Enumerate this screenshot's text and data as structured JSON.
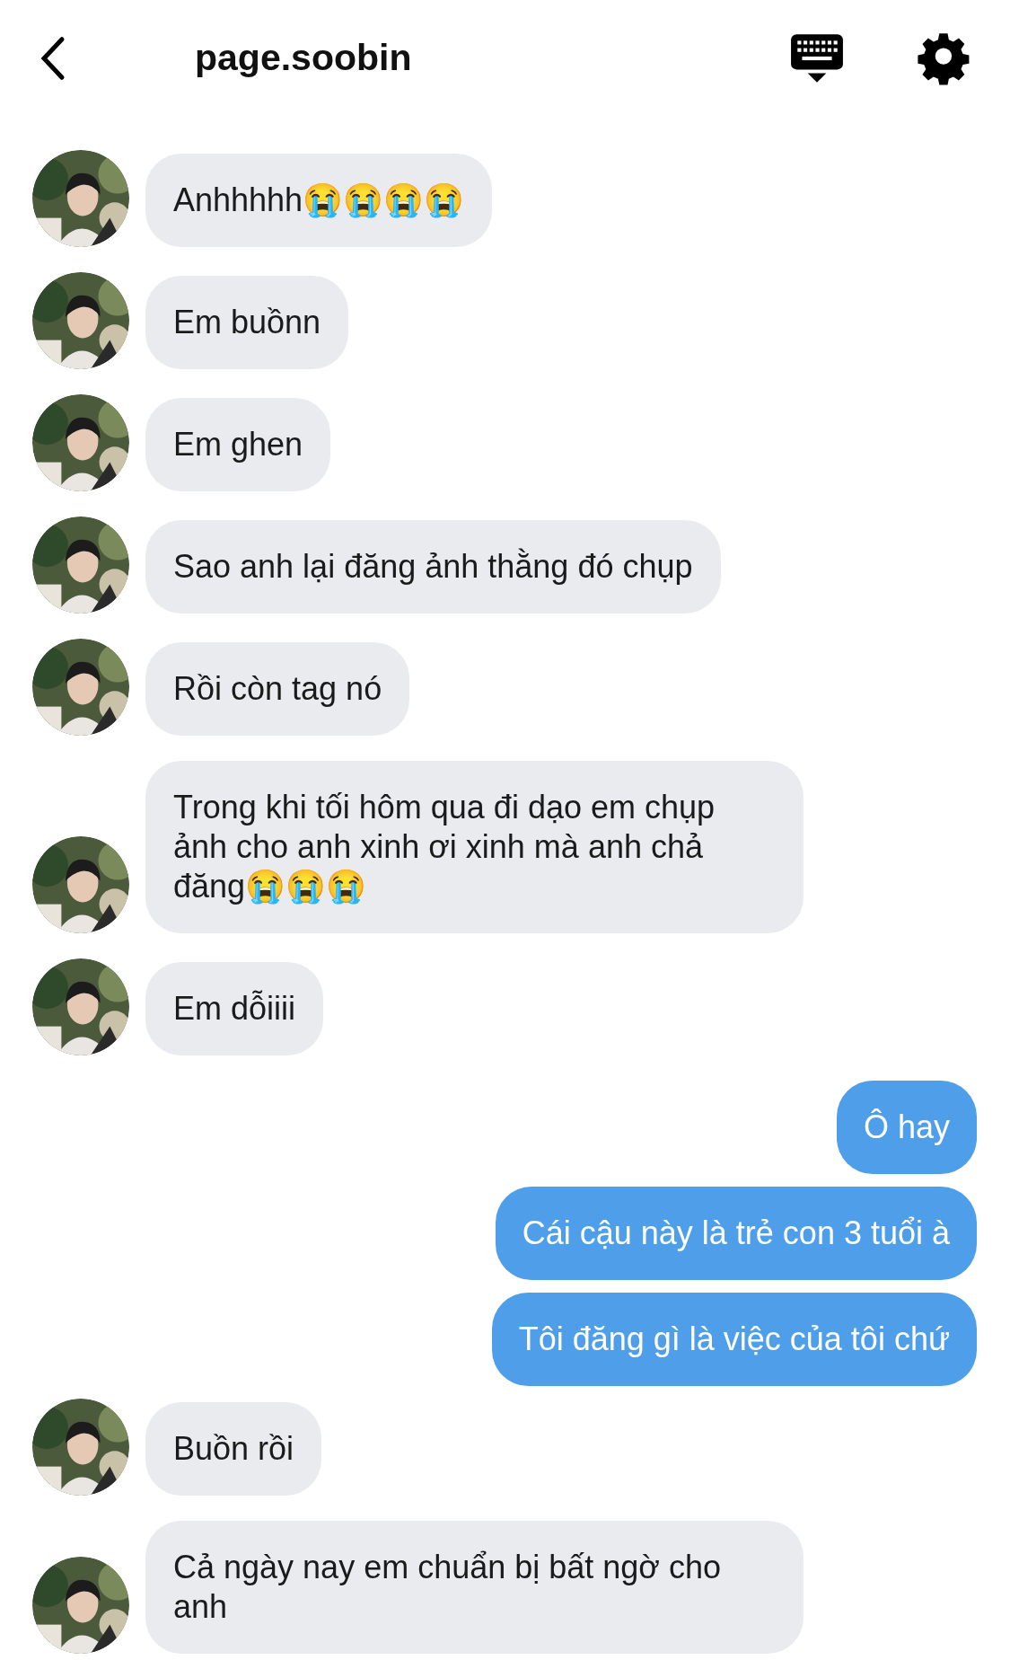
{
  "header": {
    "title": "page.soobin"
  },
  "messages": [
    {
      "kind": "incoming",
      "text": "Anhhhhh😭😭😭😭"
    },
    {
      "kind": "incoming",
      "text": "Em buồnn"
    },
    {
      "kind": "incoming",
      "text": "Em ghen"
    },
    {
      "kind": "incoming",
      "text": "Sao anh lại đăng ảnh thằng đó chụp"
    },
    {
      "kind": "incoming",
      "text": "Rồi còn tag nó"
    },
    {
      "kind": "incoming",
      "text": "Trong khi tối hôm qua đi dạo em chụp ảnh cho anh xinh ơi xinh mà anh chả đăng😭😭😭"
    },
    {
      "kind": "incoming",
      "text": "Em dỗiiii"
    },
    {
      "kind": "outgoing",
      "text": "Ô hay"
    },
    {
      "kind": "outgoing",
      "text": "Cái cậu này là trẻ con 3 tuổi à"
    },
    {
      "kind": "outgoing",
      "text": "Tôi đăng gì là việc của tôi chứ"
    },
    {
      "kind": "incoming",
      "text": "Buồn rồi"
    },
    {
      "kind": "incoming",
      "text": "Cả ngày nay em chuẩn bị bất ngờ cho anh"
    }
  ]
}
